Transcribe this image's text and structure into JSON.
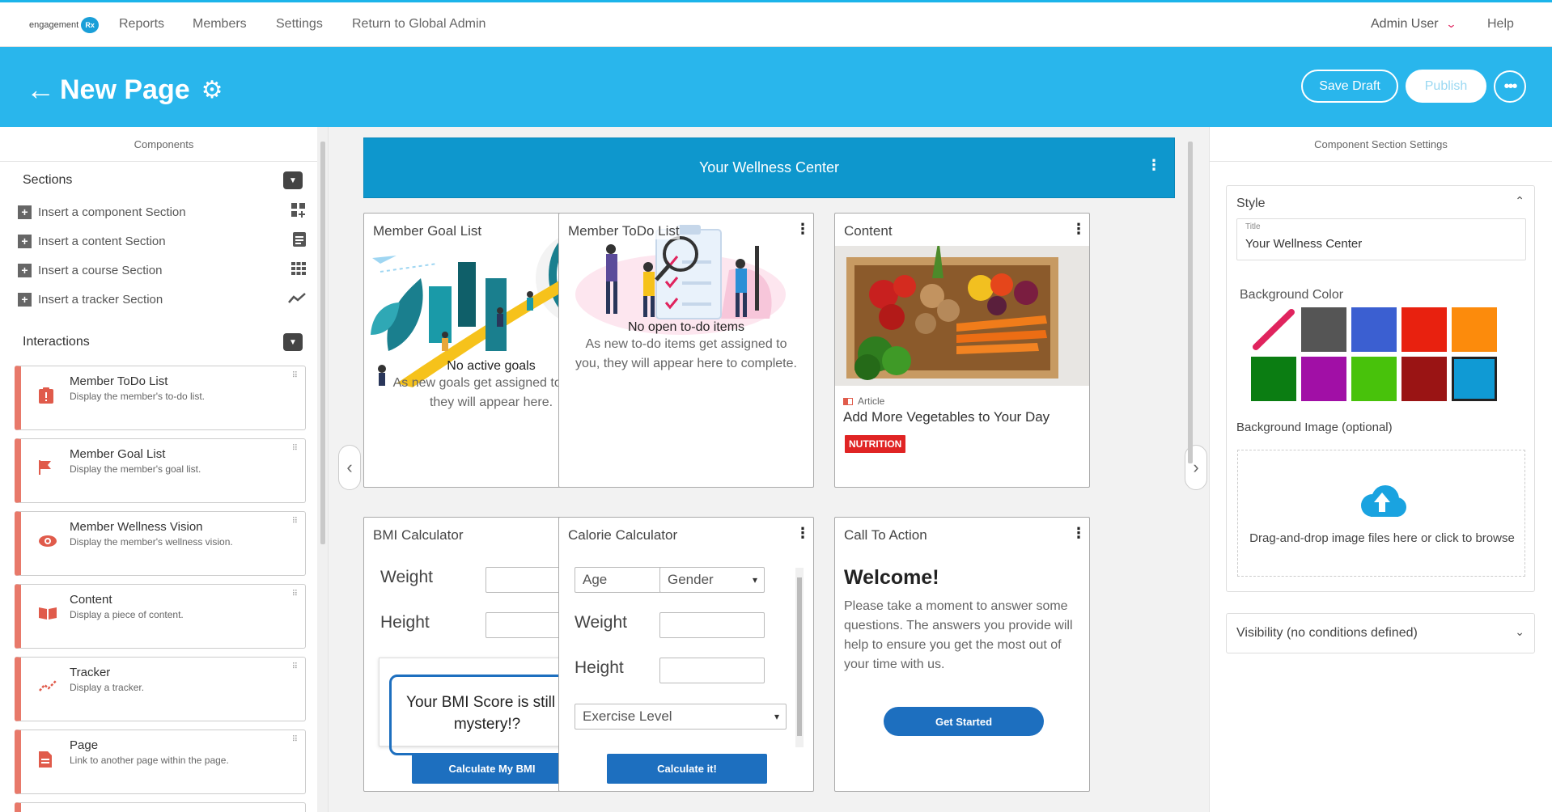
{
  "topnav": {
    "logo_text": "engagement",
    "logo_badge": "Rx",
    "links": [
      "Reports",
      "Members",
      "Settings",
      "Return to Global Admin"
    ],
    "user": "Admin User",
    "help": "Help"
  },
  "header": {
    "title": "New Page",
    "save_draft": "Save Draft",
    "publish": "Publish",
    "more": "•••"
  },
  "components_panel": {
    "title": "Components",
    "sections_title": "Sections",
    "sections": [
      {
        "label": "Insert a component Section",
        "icon": "grid-plus-icon"
      },
      {
        "label": "Insert a content Section",
        "icon": "document-icon"
      },
      {
        "label": "Insert a course Section",
        "icon": "grid-icon"
      },
      {
        "label": "Insert a tracker Section",
        "icon": "trend-icon"
      }
    ],
    "interactions_title": "Interactions",
    "interactions": [
      {
        "title": "Member ToDo List",
        "desc": "Display the member's to-do list.",
        "icon": "alert-clipboard-icon"
      },
      {
        "title": "Member Goal List",
        "desc": "Display the member's goal list.",
        "icon": "flag-icon"
      },
      {
        "title": "Member Wellness Vision",
        "desc": "Display the member's wellness vision.",
        "icon": "eye-icon"
      },
      {
        "title": "Content",
        "desc": "Display a piece of content.",
        "icon": "book-icon"
      },
      {
        "title": "Tracker",
        "desc": "Display a tracker.",
        "icon": "trend-icon"
      },
      {
        "title": "Page",
        "desc": "Link to another page within the page.",
        "icon": "page-icon"
      }
    ]
  },
  "canvas": {
    "section_title": "Your Wellness Center",
    "tiles": {
      "goal": {
        "title": "Member Goal List",
        "strong": "No active goals",
        "text": "As new goals get assigned to you, they will appear here."
      },
      "todo": {
        "title": "Member ToDo List",
        "strong": "No open to-do items",
        "text": "As new to-do items get assigned to you, they will appear here to complete."
      },
      "content": {
        "title": "Content",
        "type": "Article",
        "headline": "Add More Vegetables to Your Day",
        "tag": "NUTRITION"
      },
      "bmi": {
        "title": "BMI Calculator",
        "weight": "Weight",
        "height": "Height",
        "result": "Your BMI Score is still a mystery!?",
        "button": "Calculate My BMI"
      },
      "calorie": {
        "title": "Calorie Calculator",
        "age_placeholder": "Age",
        "gender": "Gender",
        "weight": "Weight",
        "height": "Height",
        "exercise": "Exercise Level",
        "button": "Calculate it!"
      },
      "cta": {
        "title": "Call To Action",
        "heading": "Welcome!",
        "text": "Please take a moment to answer some questions. The answers you provide will help to ensure you get the most out of your time with us.",
        "button": "Get Started"
      }
    }
  },
  "settings_panel": {
    "title": "Component Section Settings",
    "style_label": "Style",
    "title_field_label": "Title",
    "title_value": "Your Wellness Center",
    "bg_color_label": "Background Color",
    "colors": [
      "none",
      "#555555",
      "#3b5fd1",
      "#e8210f",
      "#fc8b0c",
      "#0b7d12",
      "#a10fa6",
      "#48c20b",
      "#9a1414",
      "#109ad4"
    ],
    "selected_color": "#109ad4",
    "bg_image_label": "Background Image (optional)",
    "upload_text": "Drag-and-drop image files here or click to browse",
    "visibility_label": "Visibility (no conditions defined)"
  }
}
